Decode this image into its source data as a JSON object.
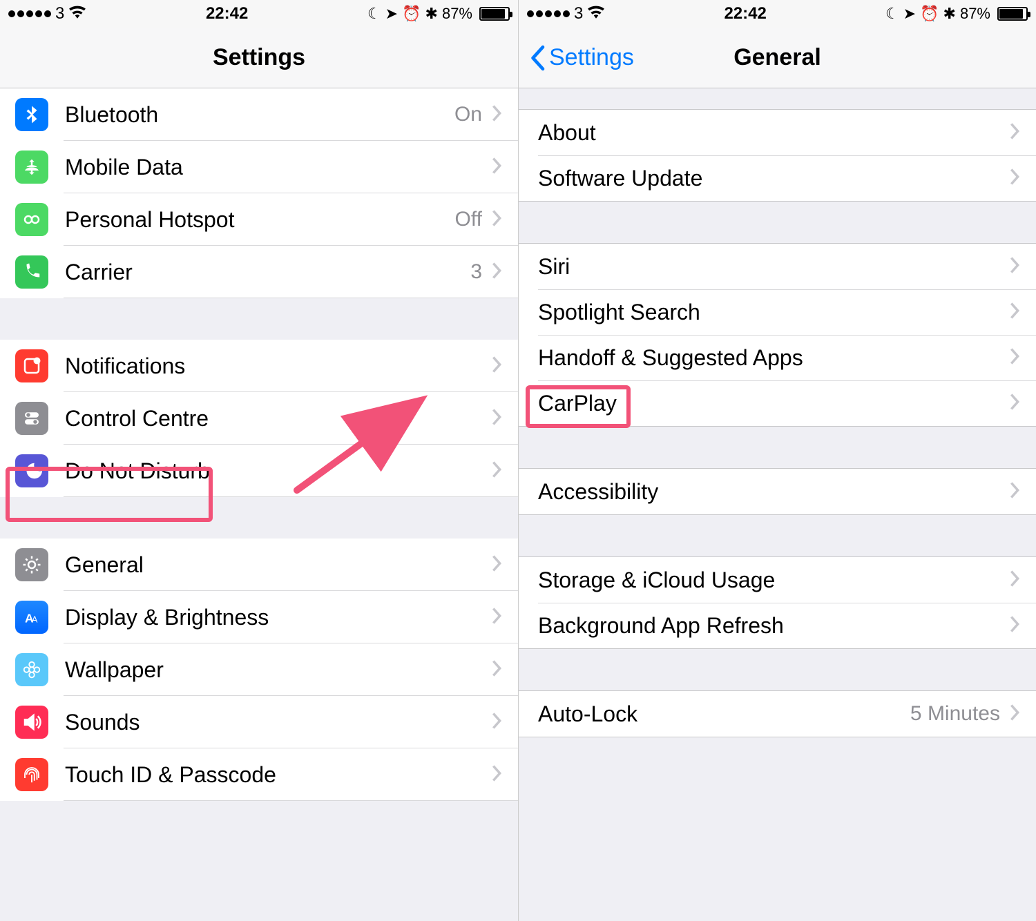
{
  "status": {
    "carrier": "3",
    "time": "22:42",
    "battery_pct": "87%"
  },
  "left": {
    "title": "Settings",
    "groups": [
      {
        "rows": [
          {
            "icon": "bluetooth-icon",
            "bg": "bg-blue",
            "label": "Bluetooth",
            "value": "On"
          },
          {
            "icon": "mobile-data-icon",
            "bg": "bg-green",
            "label": "Mobile Data",
            "value": ""
          },
          {
            "icon": "hotspot-icon",
            "bg": "bg-green",
            "label": "Personal Hotspot",
            "value": "Off"
          },
          {
            "icon": "phone-icon",
            "bg": "bg-green2",
            "label": "Carrier",
            "value": "3"
          }
        ]
      },
      {
        "rows": [
          {
            "icon": "notifications-icon",
            "bg": "bg-red",
            "label": "Notifications",
            "value": ""
          },
          {
            "icon": "control-centre-icon",
            "bg": "bg-gray",
            "label": "Control Centre",
            "value": ""
          },
          {
            "icon": "do-not-disturb-icon",
            "bg": "bg-purple",
            "label": "Do Not Disturb",
            "value": ""
          }
        ]
      },
      {
        "rows": [
          {
            "icon": "general-icon",
            "bg": "bg-gray",
            "label": "General",
            "value": ""
          },
          {
            "icon": "display-icon",
            "bg": "bg-grad-blue",
            "label": "Display & Brightness",
            "value": ""
          },
          {
            "icon": "wallpaper-icon",
            "bg": "bg-cyan",
            "label": "Wallpaper",
            "value": ""
          },
          {
            "icon": "sounds-icon",
            "bg": "bg-redpink",
            "label": "Sounds",
            "value": ""
          },
          {
            "icon": "touchid-icon",
            "bg": "bg-red2",
            "label": "Touch ID & Passcode",
            "value": ""
          }
        ]
      }
    ]
  },
  "right": {
    "back_label": "Settings",
    "title": "General",
    "groups": [
      {
        "rows": [
          {
            "label": "About",
            "value": ""
          },
          {
            "label": "Software Update",
            "value": ""
          }
        ]
      },
      {
        "rows": [
          {
            "label": "Siri",
            "value": ""
          },
          {
            "label": "Spotlight Search",
            "value": ""
          },
          {
            "label": "Handoff & Suggested Apps",
            "value": ""
          },
          {
            "label": "CarPlay",
            "value": ""
          }
        ]
      },
      {
        "rows": [
          {
            "label": "Accessibility",
            "value": ""
          }
        ]
      },
      {
        "rows": [
          {
            "label": "Storage & iCloud Usage",
            "value": ""
          },
          {
            "label": "Background App Refresh",
            "value": ""
          }
        ]
      },
      {
        "rows": [
          {
            "label": "Auto-Lock",
            "value": "5 Minutes"
          }
        ]
      }
    ]
  },
  "annotations": {
    "highlight_color": "#f25278"
  }
}
